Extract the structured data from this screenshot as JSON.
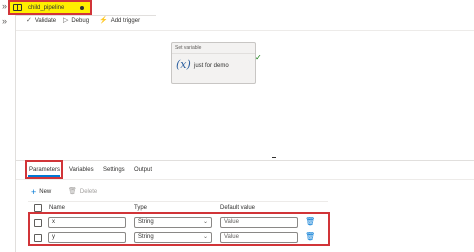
{
  "tab": {
    "title": "child_pipeline"
  },
  "toolbar": {
    "validate": "Validate",
    "debug": "Debug",
    "add_trigger": "Add trigger"
  },
  "activity": {
    "type": "Set variable",
    "icon": "(x)",
    "name": "just for demo"
  },
  "panel": {
    "tabs": [
      "Parameters",
      "Variables",
      "Settings",
      "Output"
    ],
    "active_tab": "Parameters",
    "new_label": "New",
    "delete_label": "Delete",
    "columns": {
      "name": "Name",
      "type": "Type",
      "default": "Default value"
    },
    "rows": [
      {
        "name": "x",
        "type": "String",
        "default_placeholder": "Value"
      },
      {
        "name": "y",
        "type": "String",
        "default_placeholder": "Value"
      }
    ]
  },
  "colors": {
    "tab_highlight": "#ffef00",
    "annotation_border": "#d13438",
    "accent": "#0078d4",
    "success": "#107c10"
  },
  "icons": {
    "rail": "chevron-double-right-icon",
    "validate": "check-icon",
    "debug": "play-icon",
    "add_trigger": "lightning-icon",
    "new": "plus-icon",
    "delete": "trash-icon",
    "activity": "variable-icon",
    "status": "checkmark-icon"
  }
}
